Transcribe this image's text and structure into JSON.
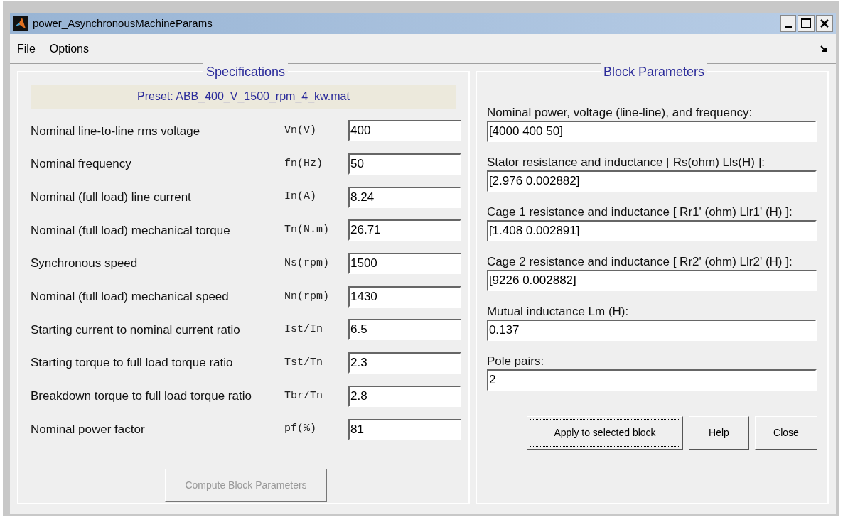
{
  "window": {
    "title": "power_AsynchronousMachineParams"
  },
  "menu": [
    {
      "label": "File"
    },
    {
      "label": "Options"
    }
  ],
  "specifications": {
    "title": "Specifications",
    "preset": "Preset:  ABB_400_V_1500_rpm_4_kw.mat",
    "rows": [
      {
        "label": "Nominal line-to-line rms voltage",
        "symbol": "Vn(V)",
        "value": "400"
      },
      {
        "label": "Nominal frequency",
        "symbol": "fn(Hz)",
        "value": "50"
      },
      {
        "label": "Nominal (full load) line current",
        "symbol": "In(A)",
        "value": "8.24"
      },
      {
        "label": "Nominal (full load) mechanical torque",
        "symbol": "Tn(N.m)",
        "value": "26.71"
      },
      {
        "label": "Synchronous speed",
        "symbol": "Ns(rpm)",
        "value": "1500"
      },
      {
        "label": "Nominal (full load) mechanical speed",
        "symbol": "Nn(rpm)",
        "value": "1430"
      },
      {
        "label": "Starting current to nominal current ratio",
        "symbol": "Ist/In",
        "value": "6.5"
      },
      {
        "label": "Starting torque to full load torque ratio",
        "symbol": "Tst/Tn",
        "value": "2.3"
      },
      {
        "label": "Breakdown torque to full load torque ratio",
        "symbol": "Tbr/Tn",
        "value": "2.8"
      },
      {
        "label": "Nominal power factor",
        "symbol": "pf(%)",
        "value": "81"
      }
    ],
    "button": {
      "label": "Compute Block Parameters",
      "disabled": true,
      "focused": false
    }
  },
  "block_parameters": {
    "title": "Block Parameters",
    "fields": [
      {
        "label": "Nominal power, voltage (line-line), and frequency:",
        "value": "[4000 400 50]"
      },
      {
        "label": "Stator resistance and inductance [ Rs(ohm)  Lls(H) ]:",
        "value": "[2.976 0.002882]"
      },
      {
        "label": "Cage 1 resistance and inductance  [ Rr1' (ohm)  Llr1' (H) ]:",
        "value": "[1.408 0.002891]"
      },
      {
        "label": "Cage 2 resistance and inductance  [ Rr2' (ohm)  Llr2' (H) ]:",
        "value": "[9226 0.002882]"
      },
      {
        "label": "Mutual inductance Lm (H):",
        "value": "0.137"
      },
      {
        "label": "Pole pairs:",
        "value": "2"
      }
    ],
    "buttons": [
      {
        "label": "Apply to selected block",
        "disabled": false,
        "focused": true
      },
      {
        "label": "Help",
        "disabled": false,
        "focused": false
      },
      {
        "label": "Close",
        "disabled": false,
        "focused": false
      }
    ]
  }
}
